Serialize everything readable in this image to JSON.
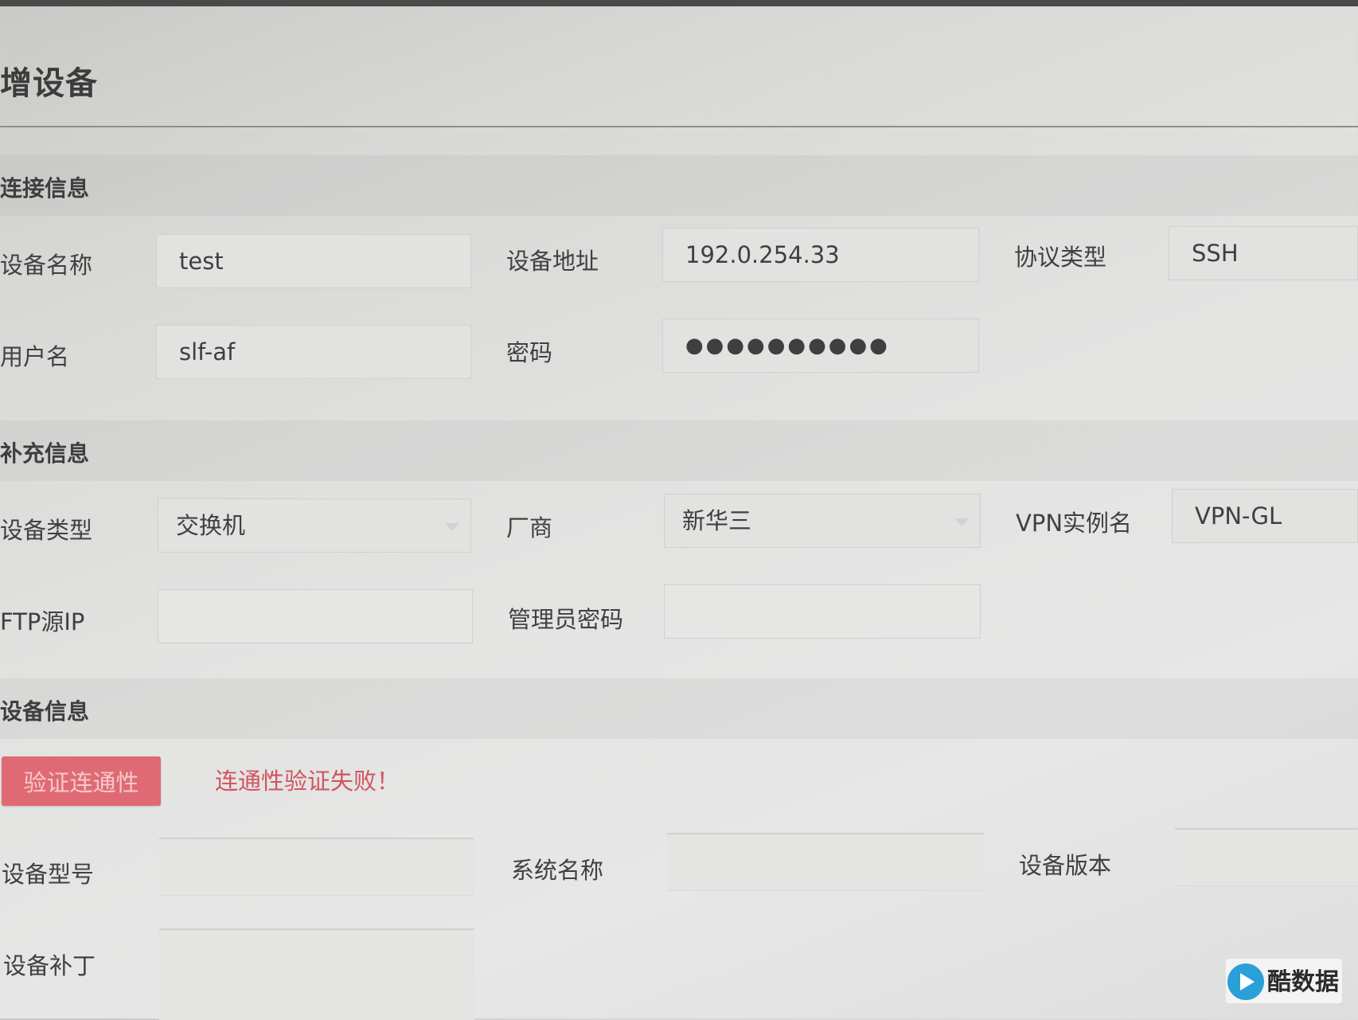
{
  "page": {
    "title": "增设备"
  },
  "sections": {
    "connection": "连接信息",
    "supplement": "补充信息",
    "device_info": "设备信息"
  },
  "connection": {
    "device_name": {
      "label": "设备名称",
      "value": "test"
    },
    "device_address": {
      "label": "设备地址",
      "value": "192.0.254.33"
    },
    "protocol_type": {
      "label": "协议类型",
      "value": "SSH"
    },
    "username": {
      "label": "用户名",
      "value": "slf-af"
    },
    "password": {
      "label": "密码",
      "value": "●●●●●●●●●●"
    }
  },
  "supplement": {
    "device_type": {
      "label": "设备类型",
      "value": "交换机"
    },
    "vendor": {
      "label": "厂商",
      "value": "新华三"
    },
    "vpn_instance": {
      "label": "VPN实例名",
      "value": "VPN-GL"
    },
    "ftp_source_ip": {
      "label": "FTP源IP",
      "value": ""
    },
    "admin_password": {
      "label": "管理员密码",
      "value": ""
    }
  },
  "device_info": {
    "verify_button": "验证连通性",
    "error_message": "连通性验证失败！",
    "device_model": {
      "label": "设备型号",
      "value": ""
    },
    "system_name": {
      "label": "系统名称",
      "value": ""
    },
    "device_version": {
      "label": "设备版本",
      "value": ""
    },
    "device_patch": {
      "label": "设备补丁",
      "value": ""
    }
  },
  "watermark": {
    "text": "酷数据"
  },
  "colors": {
    "error": "#d2545f",
    "button_bg": "#e06a73"
  }
}
